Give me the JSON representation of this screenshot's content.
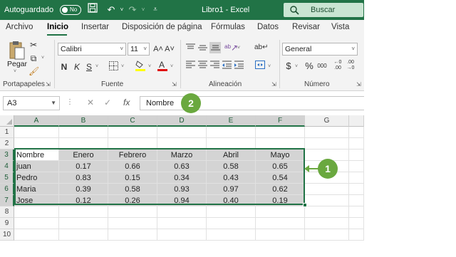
{
  "titlebar": {
    "autosave_label": "Autoguardado",
    "autosave_state": "No",
    "window_title": "Libro1  -  Excel",
    "search_label": "Buscar"
  },
  "tabs": [
    {
      "label": "Archivo"
    },
    {
      "label": "Inicio",
      "active": true
    },
    {
      "label": "Insertar"
    },
    {
      "label": "Disposición de página"
    },
    {
      "label": "Fórmulas"
    },
    {
      "label": "Datos"
    },
    {
      "label": "Revisar"
    },
    {
      "label": "Vista"
    }
  ],
  "ribbon": {
    "clipboard": {
      "paste_label": "Pegar",
      "group_label": "Portapapeles"
    },
    "font": {
      "font_name": "Calibri",
      "font_size": "11",
      "grow": "A˄",
      "shrink": "A˅",
      "bold": "N",
      "italic": "K",
      "underline": "S",
      "group_label": "Fuente"
    },
    "alignment": {
      "group_label": "Alineación"
    },
    "number": {
      "format": "General",
      "currency": "$",
      "percent": "%",
      "thousands": "000",
      "group_label": "Número"
    }
  },
  "formula_bar": {
    "name_box": "A3",
    "formula": "Nombre"
  },
  "sheet": {
    "columns": [
      "A",
      "B",
      "C",
      "D",
      "E",
      "F",
      "G"
    ],
    "rows": [
      "1",
      "2",
      "3",
      "4",
      "5",
      "6",
      "7",
      "8",
      "9",
      "10"
    ],
    "header_row": [
      "Nombre",
      "Enero",
      "Febrero",
      "Marzo",
      "Abril",
      "Mayo"
    ],
    "data": [
      [
        "juan",
        "0.17",
        "0.66",
        "0.63",
        "0.58",
        "0.65"
      ],
      [
        "Pedro",
        "0.83",
        "0.15",
        "0.34",
        "0.43",
        "0.54"
      ],
      [
        "Maria",
        "0.39",
        "0.58",
        "0.93",
        "0.97",
        "0.62"
      ],
      [
        "Jose",
        "0.12",
        "0.26",
        "0.94",
        "0.40",
        "0.19"
      ]
    ]
  },
  "callouts": {
    "one": "1",
    "two": "2"
  },
  "colors": {
    "excel_green": "#217346",
    "callout_green": "#6aa83f",
    "selection_gray": "#d4d4d4"
  }
}
